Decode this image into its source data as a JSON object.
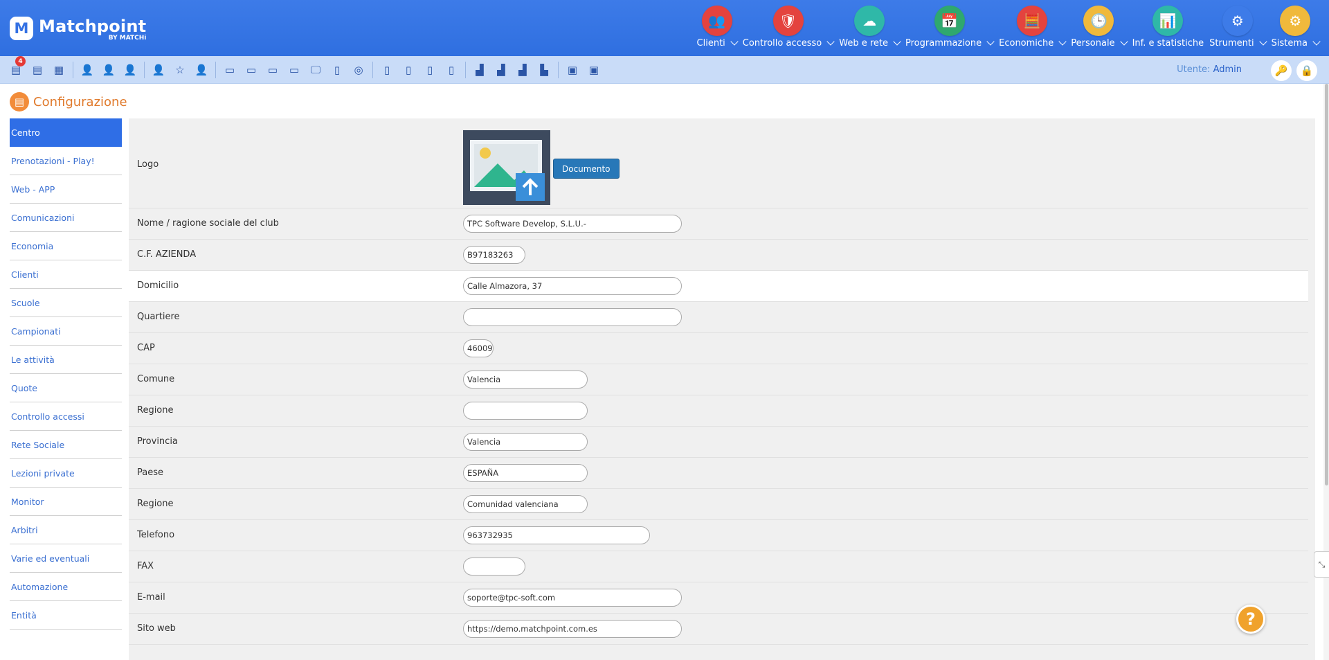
{
  "brand": {
    "name": "Matchpoint",
    "subtitle": "BY MATCHi",
    "mark": "M"
  },
  "nav": [
    {
      "label": "Clienti",
      "icon": "customers-icon",
      "color": "#e4433e",
      "glyph": "👥",
      "dropdown": true
    },
    {
      "label": "Controllo accesso",
      "icon": "shield-icon",
      "color": "#e4433e",
      "glyph": "🛡",
      "dropdown": true
    },
    {
      "label": "Web e rete",
      "icon": "cloud-network-icon",
      "color": "#2fb8a8",
      "glyph": "☁",
      "dropdown": true
    },
    {
      "label": "Programmazione",
      "icon": "calendar-icon",
      "color": "#2fa86e",
      "glyph": "📅",
      "dropdown": true
    },
    {
      "label": "Economiche",
      "icon": "calculator-icon",
      "color": "#e4433e",
      "glyph": "🧮",
      "dropdown": true
    },
    {
      "label": "Personale",
      "icon": "staff-clock-icon",
      "color": "#f0b93c",
      "glyph": "🕒",
      "dropdown": true
    },
    {
      "label": "Inf. e statistiche",
      "icon": "presentation-icon",
      "color": "#2fb8a8",
      "glyph": "📊",
      "dropdown": false
    },
    {
      "label": "Strumenti",
      "icon": "gears-icon",
      "color": "#3d7be8",
      "glyph": "⚙",
      "dropdown": true
    },
    {
      "label": "Sistema",
      "icon": "system-settings-icon",
      "color": "#f0b93c",
      "glyph": "⚙",
      "dropdown": true
    }
  ],
  "toolbar": {
    "badge": "4",
    "groups": [
      [
        {
          "name": "bookings-pending-icon",
          "g": "▤"
        },
        {
          "name": "bookings-add-icon",
          "g": "▤"
        },
        {
          "name": "calendar-day-icon",
          "g": "▦"
        }
      ],
      [
        {
          "name": "user-add-icon",
          "g": "👤"
        },
        {
          "name": "user-search-icon",
          "g": "👤"
        },
        {
          "name": "user-check-icon",
          "g": "👤"
        }
      ],
      [
        {
          "name": "user-icon",
          "g": "👤"
        },
        {
          "name": "user-star-icon",
          "g": "☆"
        },
        {
          "name": "user-group-icon",
          "g": "👤"
        }
      ],
      [
        {
          "name": "card-add-icon",
          "g": "▭"
        },
        {
          "name": "card-money-icon",
          "g": "▭"
        },
        {
          "name": "card-coin-icon",
          "g": "▭"
        },
        {
          "name": "card-remove-icon",
          "g": "▭"
        },
        {
          "name": "monitor-icon",
          "g": "🖵"
        },
        {
          "name": "document-icon",
          "g": "▯"
        },
        {
          "name": "coins-icon",
          "g": "◎"
        }
      ],
      [
        {
          "name": "report-clock-icon",
          "g": "▯"
        },
        {
          "name": "report-alert-icon",
          "g": "▯"
        },
        {
          "name": "report-check-icon",
          "g": "▯"
        },
        {
          "name": "report-user-icon",
          "g": "▯"
        }
      ],
      [
        {
          "name": "chart-up-icon",
          "g": "▟"
        },
        {
          "name": "chart-green-icon",
          "g": "▟"
        },
        {
          "name": "chart-red-icon",
          "g": "▟"
        },
        {
          "name": "chart-building-icon",
          "g": "▙"
        }
      ],
      [
        {
          "name": "screen-add-icon",
          "g": "▣"
        },
        {
          "name": "screen-settings-icon",
          "g": "▣"
        }
      ]
    ]
  },
  "user": {
    "label": "Utente:",
    "name": "Admin"
  },
  "page": {
    "title": "Configurazione"
  },
  "sidebar": [
    "Centro",
    "Prenotazioni - Play!",
    "Web - APP",
    "Comunicazioni",
    "Economia",
    "Clienti",
    "Scuole",
    "Campionati",
    "Le attività",
    "Quote",
    "Controllo accessi",
    "Rete Sociale",
    "Lezioni private",
    "Monitor",
    "Arbitri",
    "Varie ed eventuali",
    "Automazione",
    "Entità"
  ],
  "form": {
    "logo_label": "Logo",
    "document_button": "Documento",
    "fields": [
      {
        "label": "Nome / ragione sociale del club",
        "value": "TPC Software Develop, S.L.U.-",
        "width": "long"
      },
      {
        "label": "C.F. AZIENDA",
        "value": "B97183263",
        "width": "short"
      },
      {
        "label": "Domicilio",
        "value": "Calle Almazora, 37",
        "width": "long",
        "highlight": true
      },
      {
        "label": "Quartiere",
        "value": "",
        "width": "long"
      },
      {
        "label": "CAP",
        "value": "46009",
        "width": "tiny"
      },
      {
        "label": "Comune",
        "value": "Valencia",
        "width": "mid"
      },
      {
        "label": "Regione",
        "value": "",
        "width": "mid"
      },
      {
        "label": "Provincia",
        "value": "Valencia",
        "width": "mid"
      },
      {
        "label": "Paese",
        "value": "ESPAÑA",
        "width": "mid"
      },
      {
        "label": "Regione",
        "value": "Comunidad valenciana",
        "width": "mid"
      },
      {
        "label": "Telefono",
        "value": "963732935",
        "width": "phone"
      },
      {
        "label": "FAX",
        "value": "",
        "width": "short"
      },
      {
        "label": "E-mail",
        "value": "soporte@tpc-soft.com",
        "width": "long"
      },
      {
        "label": "Sito web",
        "value": "https://demo.matchpoint.com.es",
        "width": "long"
      }
    ]
  },
  "help": {
    "label": "?"
  }
}
